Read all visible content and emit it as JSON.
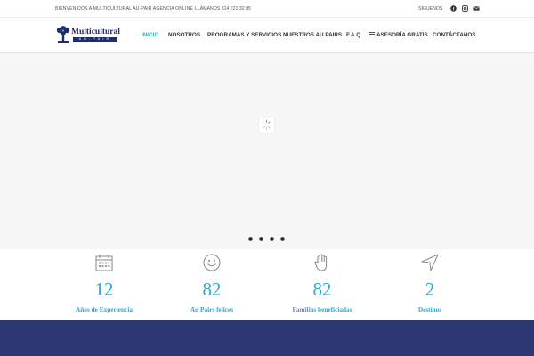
{
  "topbar": {
    "welcome": "BIENVENIDOS A MULTICULTURAL AU-PAIR AGENCIA ONLINE",
    "phone": "LLÁMANOS 314 221 32 85",
    "follow": "SÍGUENOS",
    "social_icons": [
      "facebook-icon",
      "instagram-icon",
      "email-icon"
    ]
  },
  "header": {
    "logo": {
      "brand": "Multicultural",
      "sub": "AU-PAIR"
    },
    "nav": [
      {
        "label": "INICIO",
        "active": true
      },
      {
        "label": "NOSOTROS"
      },
      {
        "label": "PROGRAMAS Y SERVICIOS"
      },
      {
        "label": "NUESTROS AU PAIRS"
      },
      {
        "label": "F.A.Q"
      },
      {
        "label": "ASESORÍA GRATIS",
        "icon": "menu-icon"
      },
      {
        "label": "CONTÁCTANOS"
      }
    ]
  },
  "slider": {
    "loading_icon": "spinner-icon",
    "dots": 4
  },
  "counters": [
    {
      "icon": "calendar-icon",
      "value": "12",
      "label": "Años de Experiencia"
    },
    {
      "icon": "smiley-icon",
      "value": "82",
      "label": "Au Pairs felices"
    },
    {
      "icon": "hand-icon",
      "value": "82",
      "label": "Familias beneficiadas"
    },
    {
      "icon": "navigation-arrow-icon",
      "value": "2",
      "label": "Destinos"
    }
  ],
  "colors": {
    "accent": "#2aa8d8",
    "brand_navy": "#1f2d6a",
    "band": "#2b3872",
    "slider_bg": "#f7f7f7"
  }
}
